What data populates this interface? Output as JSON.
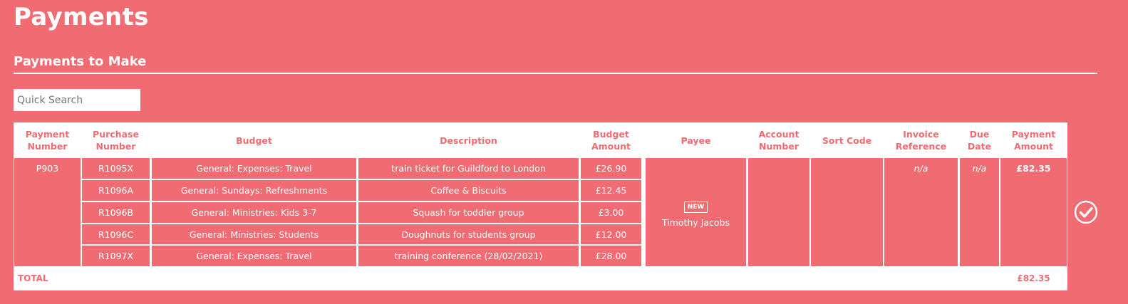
{
  "page": {
    "title": "Payments"
  },
  "section": {
    "title": "Payments to Make"
  },
  "search": {
    "placeholder": "Quick Search"
  },
  "table": {
    "headers": {
      "payment_number": "Payment Number",
      "purchase_number": "Purchase Number",
      "budget": "Budget",
      "description": "Description",
      "budget_amount": "Budget Amount",
      "payee": "Payee",
      "account_number": "Account Number",
      "sort_code": "Sort Code",
      "invoice_reference": "Invoice Reference",
      "due_date": "Due Date",
      "payment_amount": "Payment Amount"
    },
    "payment": {
      "payment_number": "P903",
      "payee_badge": "NEW",
      "payee_name": "Timothy Jacobs",
      "account_number": "",
      "sort_code": "",
      "invoice_reference": "n/a",
      "due_date": "n/a",
      "payment_amount": "£82.35"
    },
    "items": [
      {
        "purchase_number": "R1095X",
        "budget": "General: Expenses: Travel",
        "description": "train ticket for Guildford to London",
        "budget_amount": "£26.90"
      },
      {
        "purchase_number": "R1096A",
        "budget": "General: Sundays: Refreshments",
        "description": "Coffee & Biscuits",
        "budget_amount": "£12.45"
      },
      {
        "purchase_number": "R1096B",
        "budget": "General: Ministries: Kids 3-7",
        "description": "Squash for toddler group",
        "budget_amount": "£3.00"
      },
      {
        "purchase_number": "R1096C",
        "budget": "General: Ministries: Students",
        "description": "Doughnuts for students group",
        "budget_amount": "£12.00"
      },
      {
        "purchase_number": "R1097X",
        "budget": "General: Expenses: Travel",
        "description": "training conference (28/02/2021)",
        "budget_amount": "£28.00"
      }
    ],
    "total": {
      "label": "TOTAL",
      "amount": "£82.35"
    }
  },
  "actions": {
    "approve_icon": "check-circle-icon"
  },
  "colors": {
    "background": "#f06c72",
    "card": "#ffffff"
  }
}
